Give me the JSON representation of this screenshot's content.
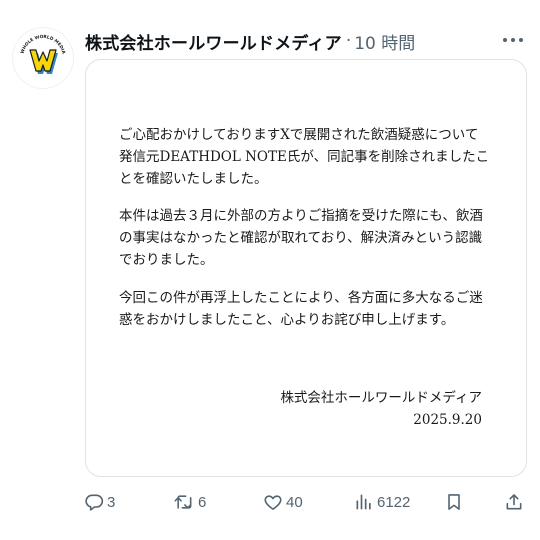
{
  "post": {
    "author": {
      "name": "株式会社ホールワールドメディア",
      "avatar_icon": "whole-world-media-logo",
      "avatar_ring_text": "WHOLE WORLD MEDIA"
    },
    "separator": "·",
    "time": "10 時間",
    "more_icon": "more-dots-icon"
  },
  "notice": {
    "paragraph_1": [
      "ご心配おかけしておりますXで展開された飲酒疑惑について",
      "発信元DEATHDOL NOTE氏が、同記事を削除されましたこ",
      "とを確認いたしました。"
    ],
    "paragraph_2": [
      "本件は過去３月に外部の方よりご指摘を受けた際にも、飲酒",
      "の事実はなかったと確認が取れており、解決済みという認識",
      "でおりました。"
    ],
    "paragraph_3": [
      "今回この件が再浮上したことにより、各方面に多大なるご迷",
      "惑をおかけしましたこと、心よりお詫び申し上げます。"
    ],
    "signature_company": "株式会社ホールワールドメディア",
    "signature_date": "2025.9.20"
  },
  "actions": {
    "reply": {
      "icon": "reply-icon",
      "count": "3"
    },
    "retweet": {
      "icon": "retweet-icon",
      "count": "6"
    },
    "like": {
      "icon": "heart-icon",
      "count": "40"
    },
    "views": {
      "icon": "views-icon",
      "count": "6122"
    },
    "bookmark": {
      "icon": "bookmark-icon"
    },
    "share": {
      "icon": "share-icon"
    }
  },
  "colors": {
    "text_primary": "#0f1419",
    "text_secondary": "#536471",
    "border": "#dfe3e6",
    "logo_yellow": "#f5d60a",
    "logo_blue": "#2f87c9"
  }
}
